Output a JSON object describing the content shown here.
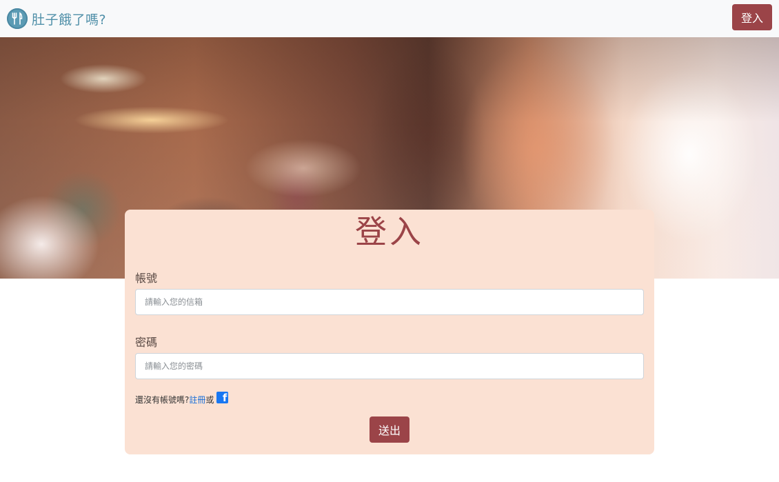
{
  "navbar": {
    "brand_name": "肚子餓了嗎?",
    "brand_icon": "utensils-icon",
    "login_label": "登入"
  },
  "hero": {
    "image": "blurred-restaurant-background"
  },
  "login_form": {
    "title": "登入",
    "account_label": "帳號",
    "account_placeholder": "請輸入您的信箱",
    "password_label": "密碼",
    "password_placeholder": "請輸入您的密碼",
    "signup_prompt": "還沒有帳號嗎?",
    "signup_link": "註冊",
    "or_text": "或",
    "facebook_icon": "facebook-icon",
    "submit_label": "送出"
  },
  "colors": {
    "accent": "#9b4448",
    "brand": "#4f8fa8",
    "card_background": "#fbe1d3",
    "navbar_background": "#f8f9fa"
  }
}
